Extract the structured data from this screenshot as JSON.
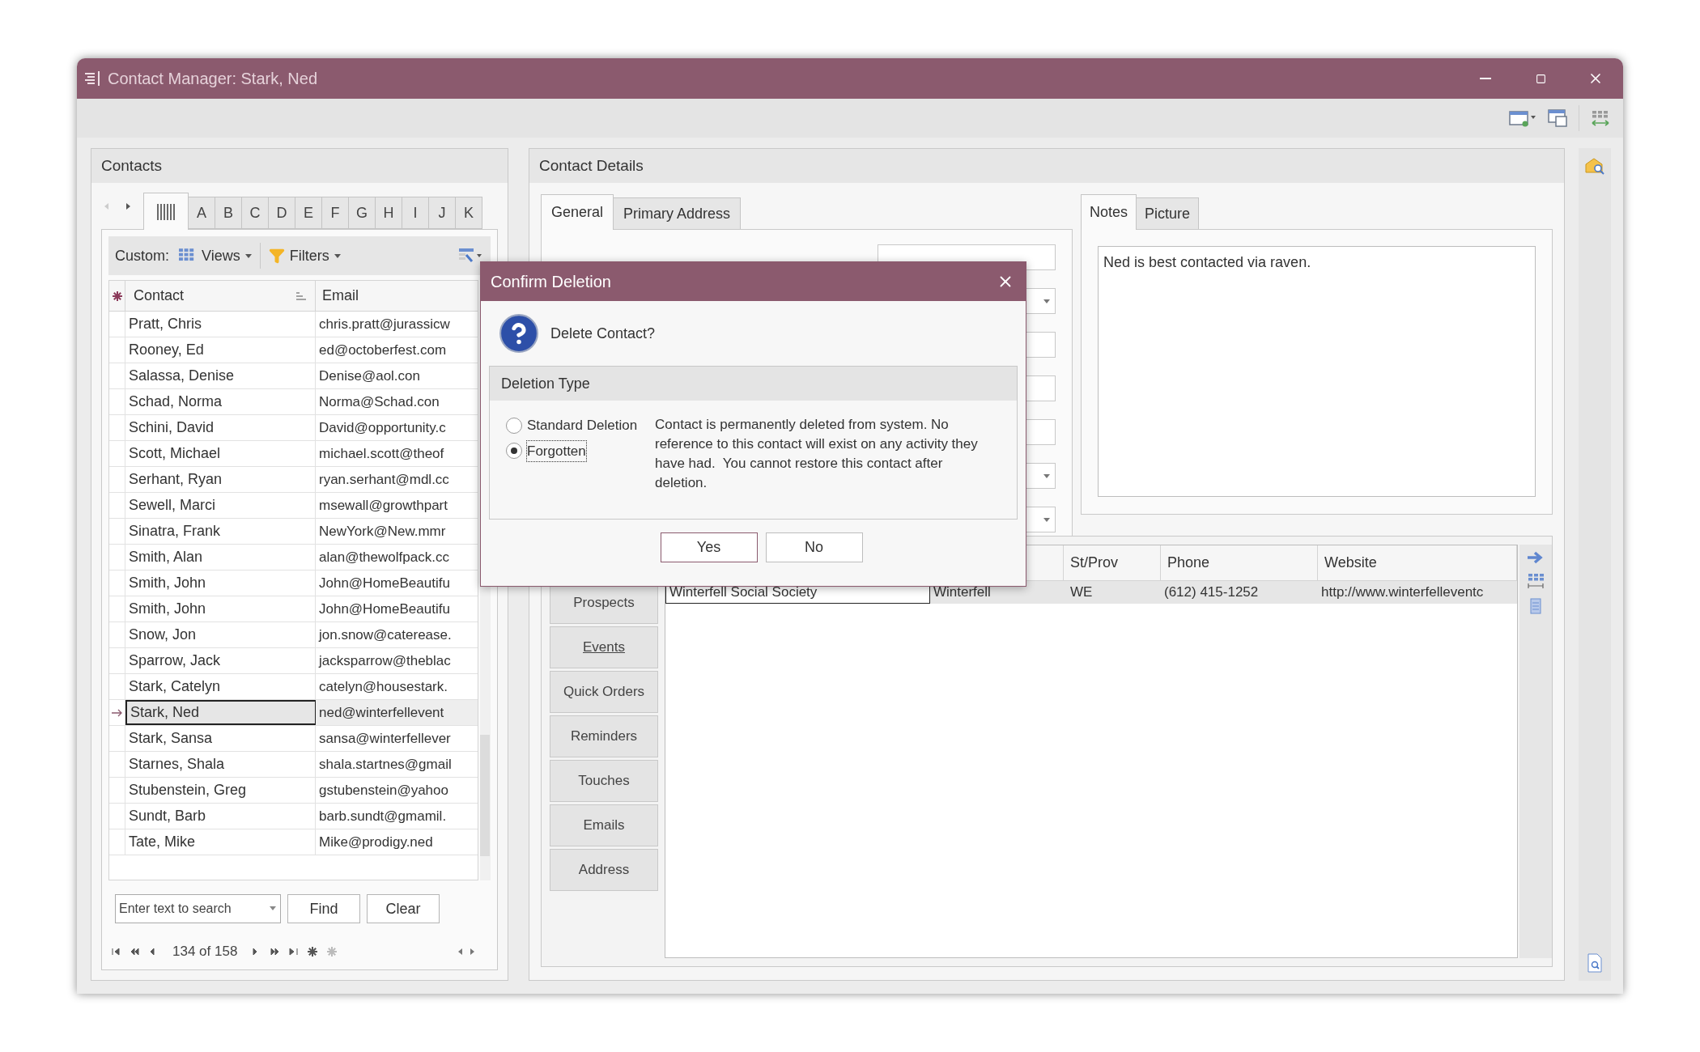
{
  "window": {
    "title": "Contact Manager: Stark, Ned"
  },
  "contacts": {
    "title": "Contacts",
    "letter_tabs": [
      {
        "kind": "all",
        "selected": true
      },
      {
        "kind": "letter",
        "label": "A",
        "selected": false
      },
      {
        "kind": "letter",
        "label": "B",
        "selected": false
      },
      {
        "kind": "letter",
        "label": "C",
        "selected": false
      },
      {
        "kind": "letter",
        "label": "D",
        "selected": false
      },
      {
        "kind": "letter",
        "label": "E",
        "selected": false
      },
      {
        "kind": "letter",
        "label": "F",
        "selected": false
      },
      {
        "kind": "letter",
        "label": "G",
        "selected": false
      },
      {
        "kind": "letter",
        "label": "H",
        "selected": false
      },
      {
        "kind": "letter",
        "label": "I",
        "selected": false
      },
      {
        "kind": "letter",
        "label": "J",
        "selected": false
      },
      {
        "kind": "letter",
        "label": "K",
        "selected": false
      }
    ],
    "toolbar": {
      "label": "Custom:",
      "views": "Views",
      "filters": "Filters"
    },
    "columns": [
      "Contact",
      "Email"
    ],
    "rows": [
      {
        "contact": "Pratt, Chris",
        "email": "chris.pratt@jurassicw",
        "selected": false
      },
      {
        "contact": "Rooney, Ed",
        "email": "ed@octoberfest.com",
        "selected": false
      },
      {
        "contact": "Salassa, Denise",
        "email": "Denise@aol.con",
        "selected": false
      },
      {
        "contact": "Schad, Norma",
        "email": "Norma@Schad.con",
        "selected": false
      },
      {
        "contact": "Schini, David",
        "email": "David@opportunity.c",
        "selected": false
      },
      {
        "contact": "Scott, Michael",
        "email": "michael.scott@theof",
        "selected": false
      },
      {
        "contact": "Serhant, Ryan",
        "email": "ryan.serhant@mdl.cc",
        "selected": false
      },
      {
        "contact": "Sewell, Marci",
        "email": "msewall@growthpart",
        "selected": false
      },
      {
        "contact": "Sinatra, Frank",
        "email": "NewYork@New.mmr",
        "selected": false
      },
      {
        "contact": "Smith, Alan",
        "email": "alan@thewolfpack.cc",
        "selected": false
      },
      {
        "contact": "Smith, John",
        "email": "John@HomeBeautifu",
        "selected": false
      },
      {
        "contact": "Smith, John",
        "email": "John@HomeBeautifu",
        "selected": false
      },
      {
        "contact": "Snow, Jon",
        "email": "jon.snow@caterease.",
        "selected": false
      },
      {
        "contact": "Sparrow, Jack",
        "email": "jacksparrow@theblac",
        "selected": false
      },
      {
        "contact": "Stark, Catelyn",
        "email": "catelyn@housestark.",
        "selected": false
      },
      {
        "contact": "Stark, Ned",
        "email": "ned@winterfellevent",
        "selected": true
      },
      {
        "contact": "Stark, Sansa",
        "email": "sansa@winterfellever",
        "selected": false
      },
      {
        "contact": "Starnes, Shala",
        "email": "shala.startnes@gmail",
        "selected": false
      },
      {
        "contact": "Stubenstein, Greg",
        "email": "gstubenstein@yahoo",
        "selected": false
      },
      {
        "contact": "Sundt, Barb",
        "email": "barb.sundt@gmamil.",
        "selected": false
      },
      {
        "contact": "Tate, Mike",
        "email": "Mike@prodigy.ned",
        "selected": false
      }
    ],
    "search": {
      "placeholder": "Enter text to search"
    },
    "buttons": [
      "Find",
      "Clear"
    ],
    "pager": "134 of 158"
  },
  "details": {
    "title": "Contact Details",
    "tabs": [
      {
        "label": "General",
        "selected": true
      },
      {
        "label": "Primary Address",
        "selected": false
      }
    ],
    "notes_tabs": [
      {
        "label": "Notes",
        "selected": true
      },
      {
        "label": "Picture",
        "selected": false
      }
    ],
    "notes": "Ned is best contacted via raven.",
    "side_tabs": [
      {
        "label": "Prospects",
        "selected": false
      },
      {
        "label": "Events",
        "selected": true
      },
      {
        "label": "Quick Orders",
        "selected": false
      },
      {
        "label": "Reminders",
        "selected": false
      },
      {
        "label": "Touches",
        "selected": false
      },
      {
        "label": "Emails",
        "selected": false
      },
      {
        "label": "Address",
        "selected": false
      }
    ],
    "grid": {
      "columns": [
        "",
        "",
        "St/Prov",
        "Phone",
        "Website"
      ],
      "rows": [
        {
          "cells": [
            "Winterfell Social Society",
            "Winterfell",
            "WE",
            "(612) 415-1252",
            "http://www.winterfelleventc"
          ],
          "selected": true
        }
      ]
    }
  },
  "dialog": {
    "title": "Confirm Deletion",
    "message": "Delete Contact?",
    "group_title": "Deletion Type",
    "options": [
      {
        "label": "Standard Deletion",
        "selected": false
      },
      {
        "label": "Forgotten",
        "selected": true
      }
    ],
    "description": "Contact is permanently deleted from system. No reference to this contact will exist on any activity they have had.  You cannot restore this contact after deletion.",
    "buttons": [
      {
        "label": "Yes",
        "default": true
      },
      {
        "label": "No",
        "default": false
      }
    ]
  }
}
